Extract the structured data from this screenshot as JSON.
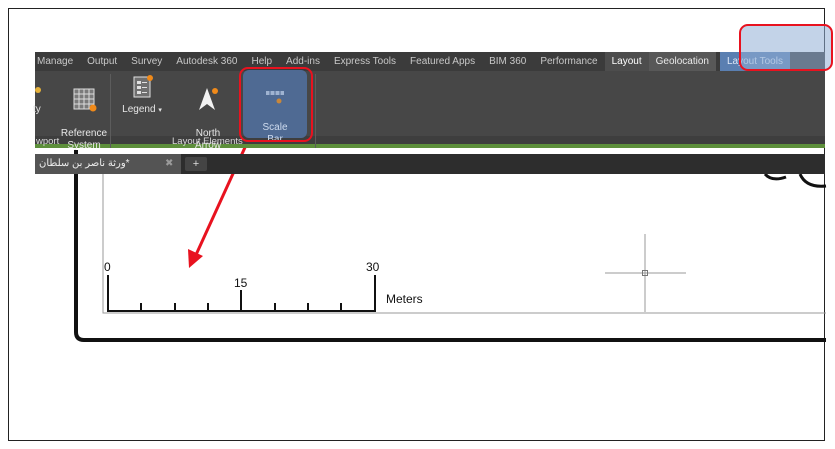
{
  "menu": {
    "tabs": [
      "Manage",
      "Output",
      "Survey",
      "Autodesk 360",
      "Help",
      "Add-ins",
      "Express Tools",
      "Featured Apps",
      "BIM 360",
      "Performance",
      "Layout",
      "Geolocation"
    ],
    "contextual_tab": "Layout Tools"
  },
  "ribbon": {
    "partial_left_label": "ty",
    "reference_system": "Reference\nSystem",
    "legend": "Legend",
    "north_arrow": "North\nArrow",
    "scale_bar": "Scale\nBar",
    "group_viewport": "wport",
    "group_layout_elements": "Layout Elements"
  },
  "doc_tab": {
    "title": "*ورثة ناصر بن سلطان",
    "close": "✖",
    "add": "+"
  },
  "scale_bar": {
    "label_start": "0",
    "label_mid": "15",
    "label_end": "30",
    "units": "Meters"
  },
  "colors": {
    "highlight": "#e8121f",
    "contextual_tab": "#5a7fb1",
    "ribbon_bg": "#474747",
    "group_bar_accent": "#5d8f3b"
  }
}
